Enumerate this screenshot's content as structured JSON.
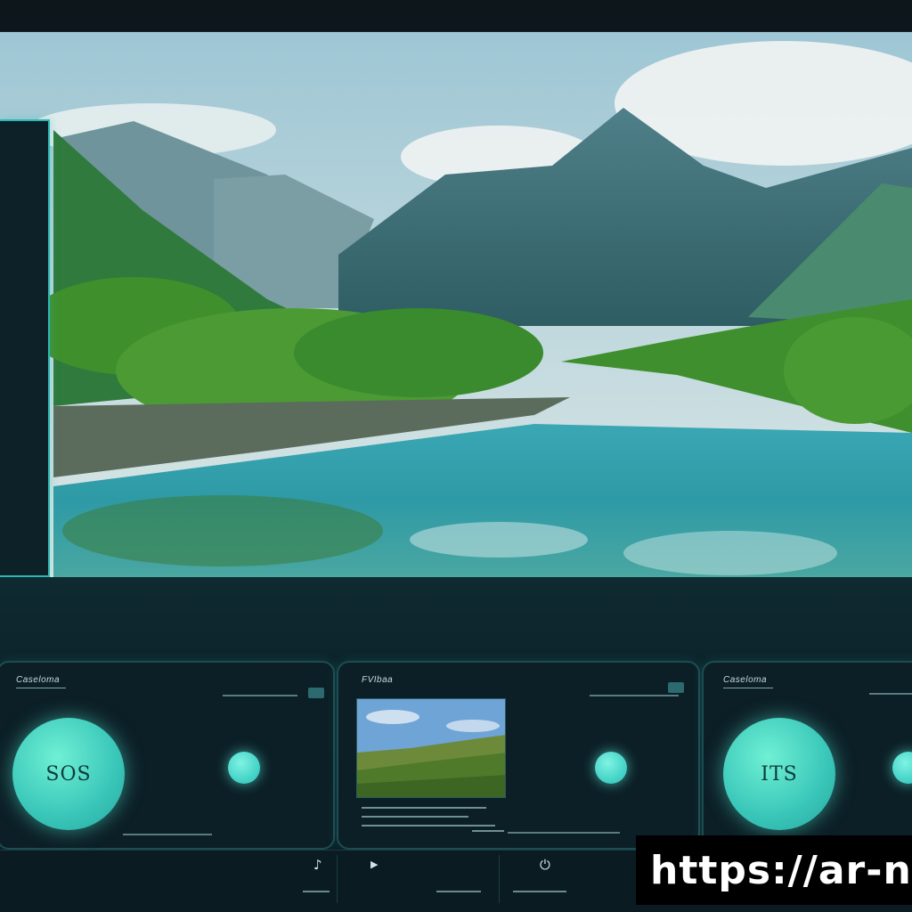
{
  "cards": {
    "left": {
      "title": "Caseloma",
      "circle_label": "SOS"
    },
    "middle": {
      "title": "FVIbaa"
    },
    "right": {
      "title": "Caseloma",
      "circle_label": "ITS"
    }
  },
  "bottom_bar": {
    "icons": [
      "music-note-icon",
      "play-icon",
      "power-icon"
    ]
  },
  "watermark": {
    "text": "https://ar-n"
  },
  "colors": {
    "accent": "#3fcfc4",
    "panel_border": "#2fb7b3",
    "background": "#0b1a20"
  }
}
